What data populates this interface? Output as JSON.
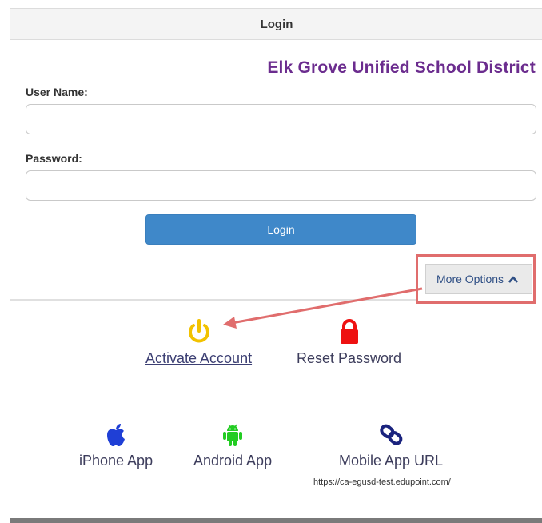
{
  "header": {
    "title": "Login"
  },
  "district": {
    "name": "Elk Grove Unified School District"
  },
  "form": {
    "username_label": "User Name:",
    "username_value": "",
    "password_label": "Password:",
    "password_value": "",
    "login_label": "Login"
  },
  "more_options": {
    "label": "More Options",
    "icon": "chevron-up-icon"
  },
  "options": {
    "activate": {
      "label": "Activate Account",
      "icon": "power-icon",
      "color": "#f2c200"
    },
    "reset": {
      "label": "Reset Password",
      "icon": "lock-icon",
      "color": "#ee1111"
    }
  },
  "apps": {
    "iphone": {
      "label": "iPhone App",
      "icon": "apple-icon",
      "color": "#1f3fd6"
    },
    "android": {
      "label": "Android App",
      "icon": "android-icon",
      "color": "#22cc22"
    },
    "mobile_url": {
      "label": "Mobile App URL",
      "icon": "link-icon",
      "url": "https://ca-egusd-test.edupoint.com/",
      "color": "#1a237e"
    }
  },
  "colors": {
    "accent": "#3f88c9",
    "district": "#6b2c8e",
    "highlight": "#e06d6d"
  }
}
